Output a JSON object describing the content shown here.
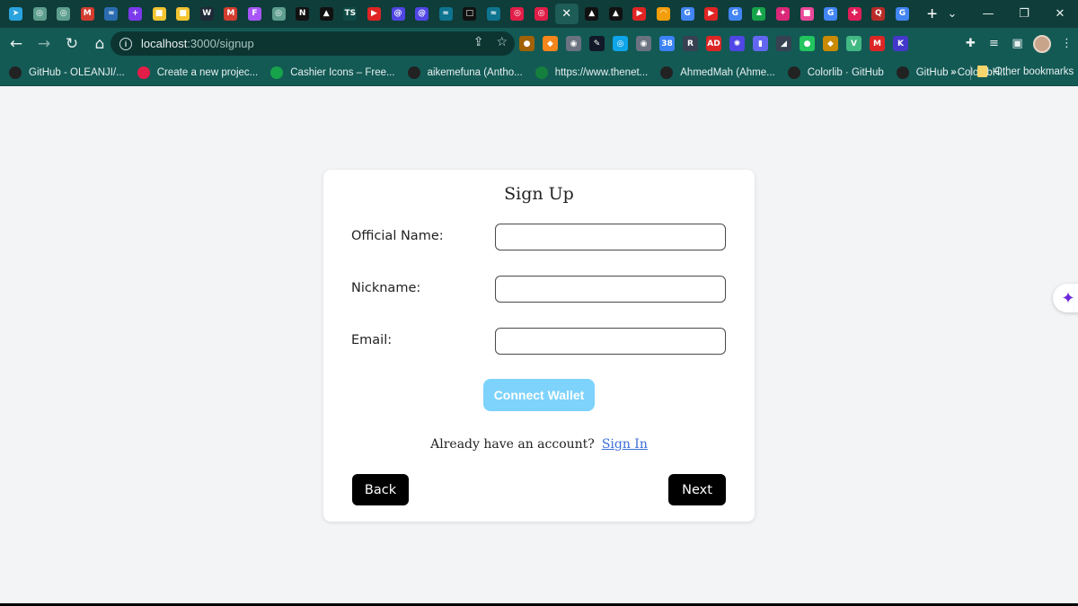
{
  "browser": {
    "tabs": [
      {
        "icon": "telegram-icon",
        "glyph": "➤",
        "color": "#2aa3de"
      },
      {
        "icon": "chatgpt-icon",
        "glyph": "◎",
        "color": "#5e9e8e"
      },
      {
        "icon": "chatgpt-icon",
        "glyph": "◎",
        "color": "#5e9e8e"
      },
      {
        "icon": "gmail-icon",
        "glyph": "M",
        "color": "#d33c2f"
      },
      {
        "icon": "wave-icon",
        "glyph": "≈",
        "color": "#2b6cb0"
      },
      {
        "icon": "plus-app-icon",
        "glyph": "+",
        "color": "#7c3aed"
      },
      {
        "icon": "ukraine-icon",
        "glyph": "■",
        "color": "#f4c430"
      },
      {
        "icon": "ukraine-icon",
        "glyph": "■",
        "color": "#f4c430"
      },
      {
        "icon": "webflow-icon",
        "glyph": "W",
        "color": "#1f2937"
      },
      {
        "icon": "gmail-icon",
        "glyph": "M",
        "color": "#d33c2f"
      },
      {
        "icon": "figma-icon",
        "glyph": "F",
        "color": "#a855f7"
      },
      {
        "icon": "chatgpt-icon",
        "glyph": "◎",
        "color": "#5e9e8e"
      },
      {
        "icon": "nextjs-icon",
        "glyph": "N",
        "color": "#111111"
      },
      {
        "icon": "vercel-icon",
        "glyph": "▲",
        "color": "#111111"
      },
      {
        "icon": "typescript-icon",
        "glyph": "TS",
        "color": "#0f4a46"
      },
      {
        "icon": "youtube-icon",
        "glyph": "▶",
        "color": "#e02424"
      },
      {
        "icon": "cssbuttons-icon",
        "glyph": "@",
        "color": "#4f46e5"
      },
      {
        "icon": "cssbuttons-icon",
        "glyph": "@",
        "color": "#4f46e5"
      },
      {
        "icon": "tailwind-icon",
        "glyph": "≈",
        "color": "#0e7490"
      },
      {
        "icon": "square-app-icon",
        "glyph": "□",
        "color": "#111111"
      },
      {
        "icon": "tailwind-icon",
        "glyph": "≈",
        "color": "#0e7490"
      },
      {
        "icon": "target-icon",
        "glyph": "◎",
        "color": "#e11d48"
      },
      {
        "icon": "target-icon",
        "glyph": "◎",
        "color": "#e11d48"
      },
      {
        "icon": "close-icon",
        "glyph": "✕",
        "color": "#1d5c57",
        "active": true
      },
      {
        "icon": "vercel-icon",
        "glyph": "▲",
        "color": "#111111"
      },
      {
        "icon": "vercel-icon",
        "glyph": "▲",
        "color": "#111111"
      },
      {
        "icon": "youtube-icon",
        "glyph": "▶",
        "color": "#e02424"
      },
      {
        "icon": "rainbow-icon",
        "glyph": "◠",
        "color": "#f59e0b"
      },
      {
        "icon": "google-icon",
        "glyph": "G",
        "color": "#4285f4"
      },
      {
        "icon": "youtube-icon",
        "glyph": "▶",
        "color": "#e02424"
      },
      {
        "icon": "google-icon",
        "glyph": "G",
        "color": "#4285f4"
      },
      {
        "icon": "bell-app-icon",
        "glyph": "♟",
        "color": "#16a34a"
      },
      {
        "icon": "sparkle-app-icon",
        "glyph": "✦",
        "color": "#db2777"
      },
      {
        "icon": "pink-square-icon",
        "glyph": "■",
        "color": "#ec4899"
      },
      {
        "icon": "google-icon",
        "glyph": "G",
        "color": "#4285f4"
      },
      {
        "icon": "slack-icon",
        "glyph": "✚",
        "color": "#e01e5a"
      },
      {
        "icon": "quora-icon",
        "glyph": "Q",
        "color": "#b92b27"
      },
      {
        "icon": "google-icon",
        "glyph": "G",
        "color": "#4285f4"
      }
    ],
    "new_tab": "+",
    "window_controls": [
      "⌄",
      "—",
      "❐",
      "✕"
    ],
    "url_host": "localhost",
    "url_path": ":3000/signup",
    "extensions": [
      {
        "icon": "bulb-ext-icon",
        "glyph": "●",
        "color": "#a16207"
      },
      {
        "icon": "metamask-icon",
        "glyph": "◆",
        "color": "#f6851b"
      },
      {
        "icon": "camera-ext-icon",
        "glyph": "◉",
        "color": "#6b7280"
      },
      {
        "icon": "pen-ext-icon",
        "glyph": "✎",
        "color": "#111827"
      },
      {
        "icon": "compass-ext-icon",
        "glyph": "◎",
        "color": "#0ea5e9"
      },
      {
        "icon": "target-ext-icon",
        "glyph": "◉",
        "color": "#6b7280"
      },
      {
        "icon": "calendar-ext-icon",
        "glyph": "38",
        "color": "#3b82f6"
      },
      {
        "icon": "reader-ext-icon",
        "glyph": "R",
        "color": "#374151"
      },
      {
        "icon": "adblock-ext-icon",
        "glyph": "AD",
        "color": "#dc2626"
      },
      {
        "icon": "sun-ext-icon",
        "glyph": "✺",
        "color": "#4f46e5"
      },
      {
        "icon": "bookmark-ext-icon",
        "glyph": "▮",
        "color": "#6366f1"
      },
      {
        "icon": "eraser-ext-icon",
        "glyph": "◢",
        "color": "#374151"
      },
      {
        "icon": "green-dot-ext-icon",
        "glyph": "●",
        "color": "#22c55e"
      },
      {
        "icon": "bee-ext-icon",
        "glyph": "◆",
        "color": "#ca8a04"
      },
      {
        "icon": "vue-ext-icon",
        "glyph": "V",
        "color": "#42b883"
      },
      {
        "icon": "m-ext-icon",
        "glyph": "M",
        "color": "#dc2626"
      },
      {
        "icon": "k-ext-icon",
        "glyph": "K",
        "color": "#4338ca"
      }
    ],
    "bookmarks": [
      {
        "label": "GitHub - OLEANJI/...",
        "icon": "github-icon",
        "color": "#222222"
      },
      {
        "label": "Create a new projec...",
        "icon": "store-icon",
        "color": "#e11d48"
      },
      {
        "label": "Cashier Icons – Free...",
        "icon": "cashier-icon",
        "color": "#16a34a"
      },
      {
        "label": "aikemefuna (Antho...",
        "icon": "github-icon",
        "color": "#222222"
      },
      {
        "label": "https://www.thenet...",
        "icon": "n-icon",
        "color": "#15803d"
      },
      {
        "label": "AhmedMah (Ahme...",
        "icon": "github-icon",
        "color": "#222222"
      },
      {
        "label": "Colorlib · GitHub",
        "icon": "github-icon",
        "color": "#222222"
      },
      {
        "label": "GitHub - ColorlibH...",
        "icon": "github-icon",
        "color": "#222222"
      }
    ],
    "bookmarks_more": "»",
    "other_bookmarks": "Other bookmarks"
  },
  "signup": {
    "title": "Sign Up",
    "fields": [
      {
        "label": "Official Name:",
        "value": ""
      },
      {
        "label": "Nickname:",
        "value": ""
      },
      {
        "label": "Email:",
        "value": ""
      }
    ],
    "connect_wallet": "Connect Wallet",
    "already_text": "Already have an account?",
    "sign_in": "Sign In",
    "back": "Back",
    "next": "Next"
  }
}
